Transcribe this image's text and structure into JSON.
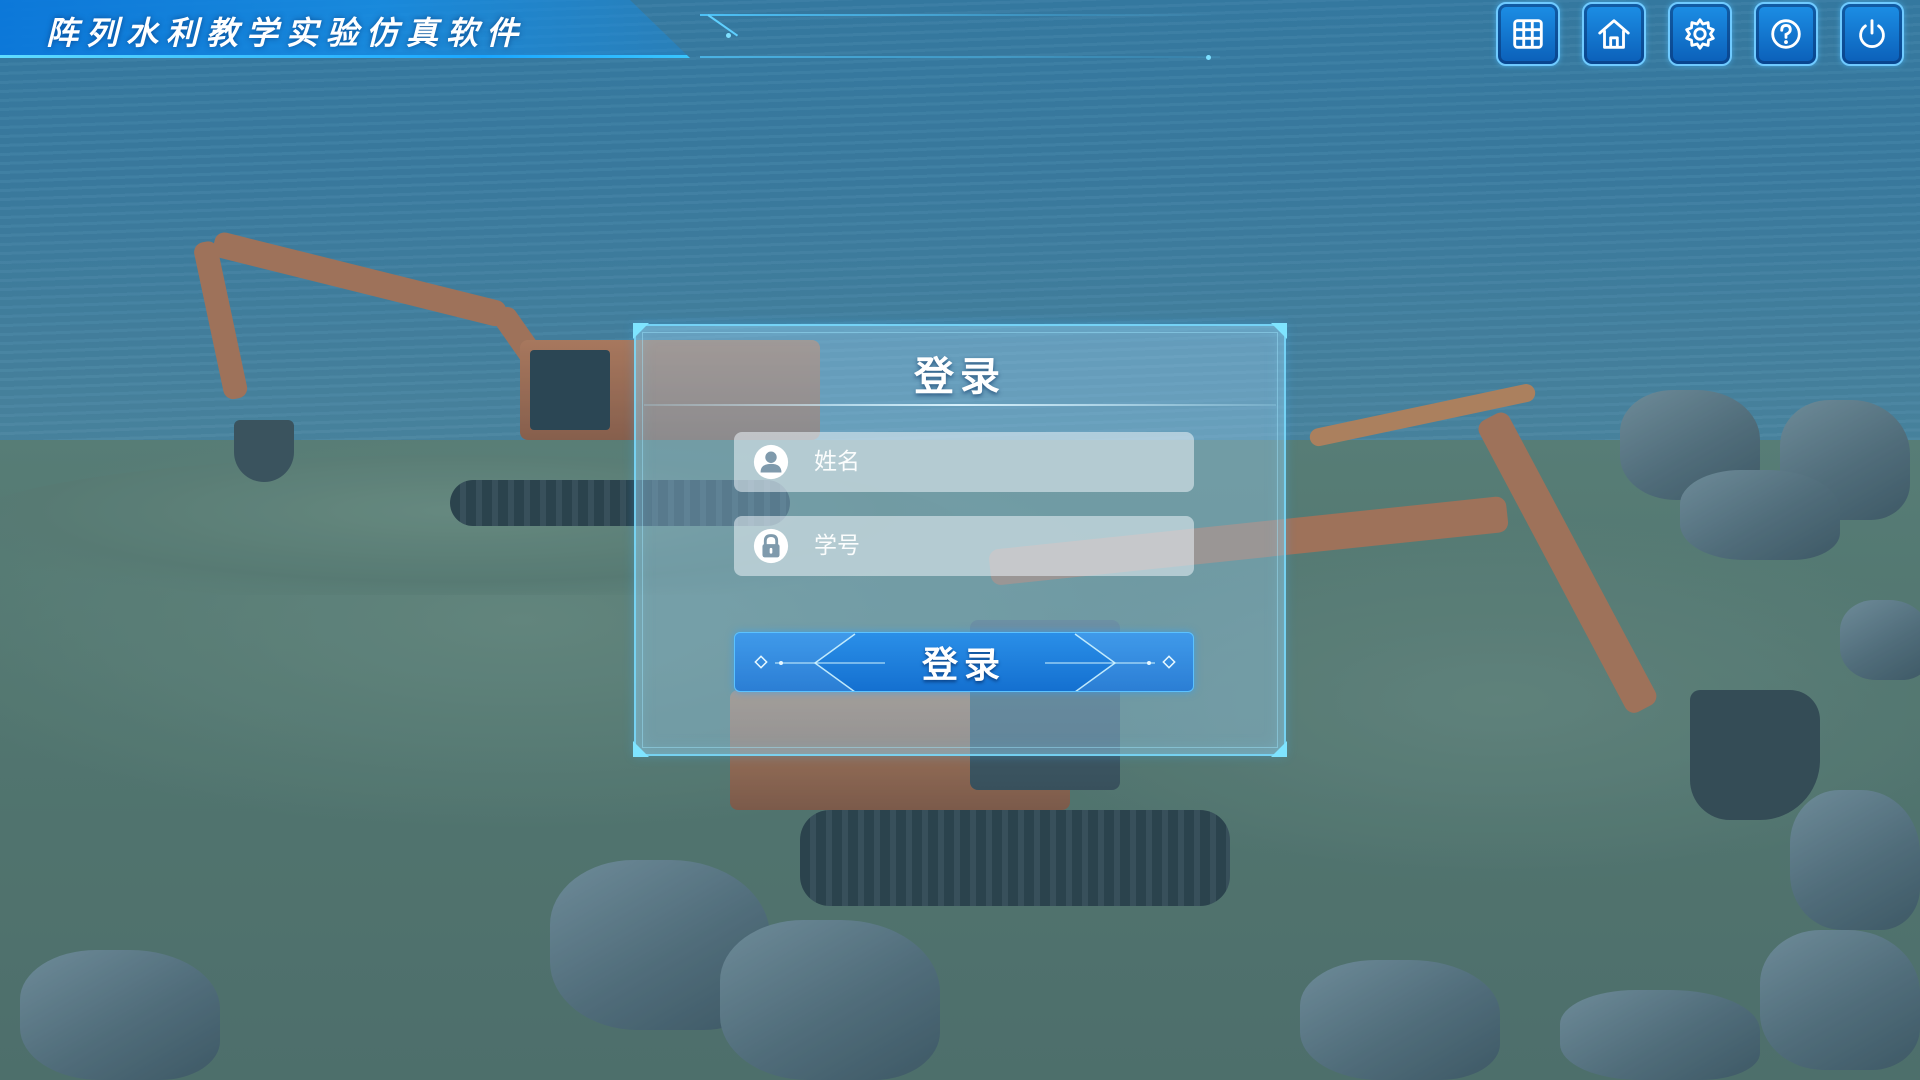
{
  "app": {
    "title": "阵列水利教学实验仿真软件"
  },
  "toolbar": {
    "buttons": [
      {
        "name": "grid-menu-button",
        "icon": "grid-icon"
      },
      {
        "name": "home-button",
        "icon": "home-icon"
      },
      {
        "name": "settings-button",
        "icon": "gear-icon"
      },
      {
        "name": "help-button",
        "icon": "help-circle-icon"
      },
      {
        "name": "power-button",
        "icon": "power-icon"
      }
    ]
  },
  "login": {
    "title": "登录",
    "name_field": {
      "placeholder": "姓名",
      "value": "",
      "icon": "user-icon"
    },
    "id_field": {
      "placeholder": "学号",
      "value": "",
      "icon": "lock-icon"
    },
    "submit_label": "登录"
  },
  "colors": {
    "accent": "#1a8cf0",
    "accent_light": "#6fcaff",
    "panel_border": "#7fe4ff",
    "text": "#ffffff"
  }
}
